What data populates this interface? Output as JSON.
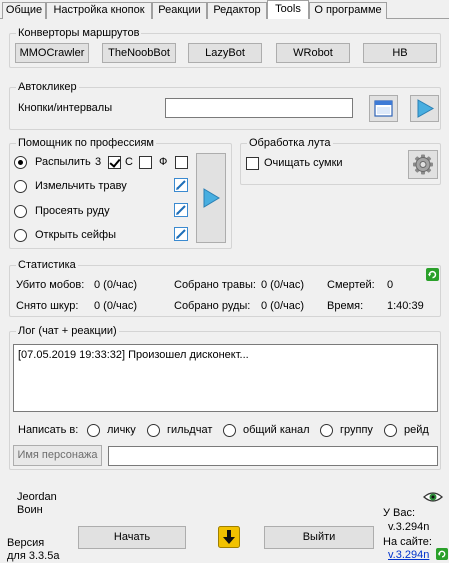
{
  "tabs": [
    "Общие",
    "Настройка кнопок",
    "Реакции",
    "Редактор",
    "Tools",
    "О программе"
  ],
  "converters": {
    "title": "Конверторы маршрутов",
    "buttons": [
      "MMOCrawler",
      "TheNoobBot",
      "LazyBot",
      "WRobot",
      "HB"
    ]
  },
  "autoclicker": {
    "title": "Автокликер",
    "label": "Кнопки/интервалы",
    "value": ""
  },
  "prof": {
    "title": "Помощник по профессиям",
    "spray_label": "Распылить",
    "spray_count": "3",
    "check_c": "С",
    "check_f": "Ф",
    "grind_label": "Измельчить траву",
    "sift_label": "Просеять руду",
    "open_label": "Открыть сейфы"
  },
  "loot": {
    "title": "Обработка лута",
    "clear_label": "Очищать сумки"
  },
  "stats": {
    "title": "Статистика",
    "killed_label": "Убито мобов:",
    "killed_value": "0 (0/час)",
    "herbs_label": "Собрано травы:",
    "herbs_value": "0 (0/час)",
    "deaths_label": "Смертей:",
    "deaths_value": "0",
    "skinned_label": "Снято шкур:",
    "skinned_value": "0 (0/час)",
    "ore_label": "Собрано руды:",
    "ore_value": "0 (0/час)",
    "time_label": "Время:",
    "time_value": "1:40:39"
  },
  "log": {
    "title": "Лог (чат + реакции)",
    "text": "[07.05.2019 19:33:32] Произошел дисконект...",
    "write_in": "Написать в:",
    "options": [
      "личку",
      "гильдчат",
      "общий канал",
      "группу",
      "рейд"
    ],
    "char_name_button": "Имя персонажа",
    "message_value": ""
  },
  "footer": {
    "char_name": "Jeordan",
    "char_class": "Воин",
    "version_label": "Версия",
    "version_for": "для 3.3.5а",
    "start": "Начать",
    "exit": "Выйти",
    "you_have_label": "У Вас:",
    "you_have_version": "v.3.294n",
    "site_label": "На сайте:",
    "site_version": "v.3.294n"
  },
  "colors": {
    "accent_arrow": "#3aa0d8",
    "download_arrow": "#f2c200",
    "refresh_green": "#2aa02a"
  }
}
